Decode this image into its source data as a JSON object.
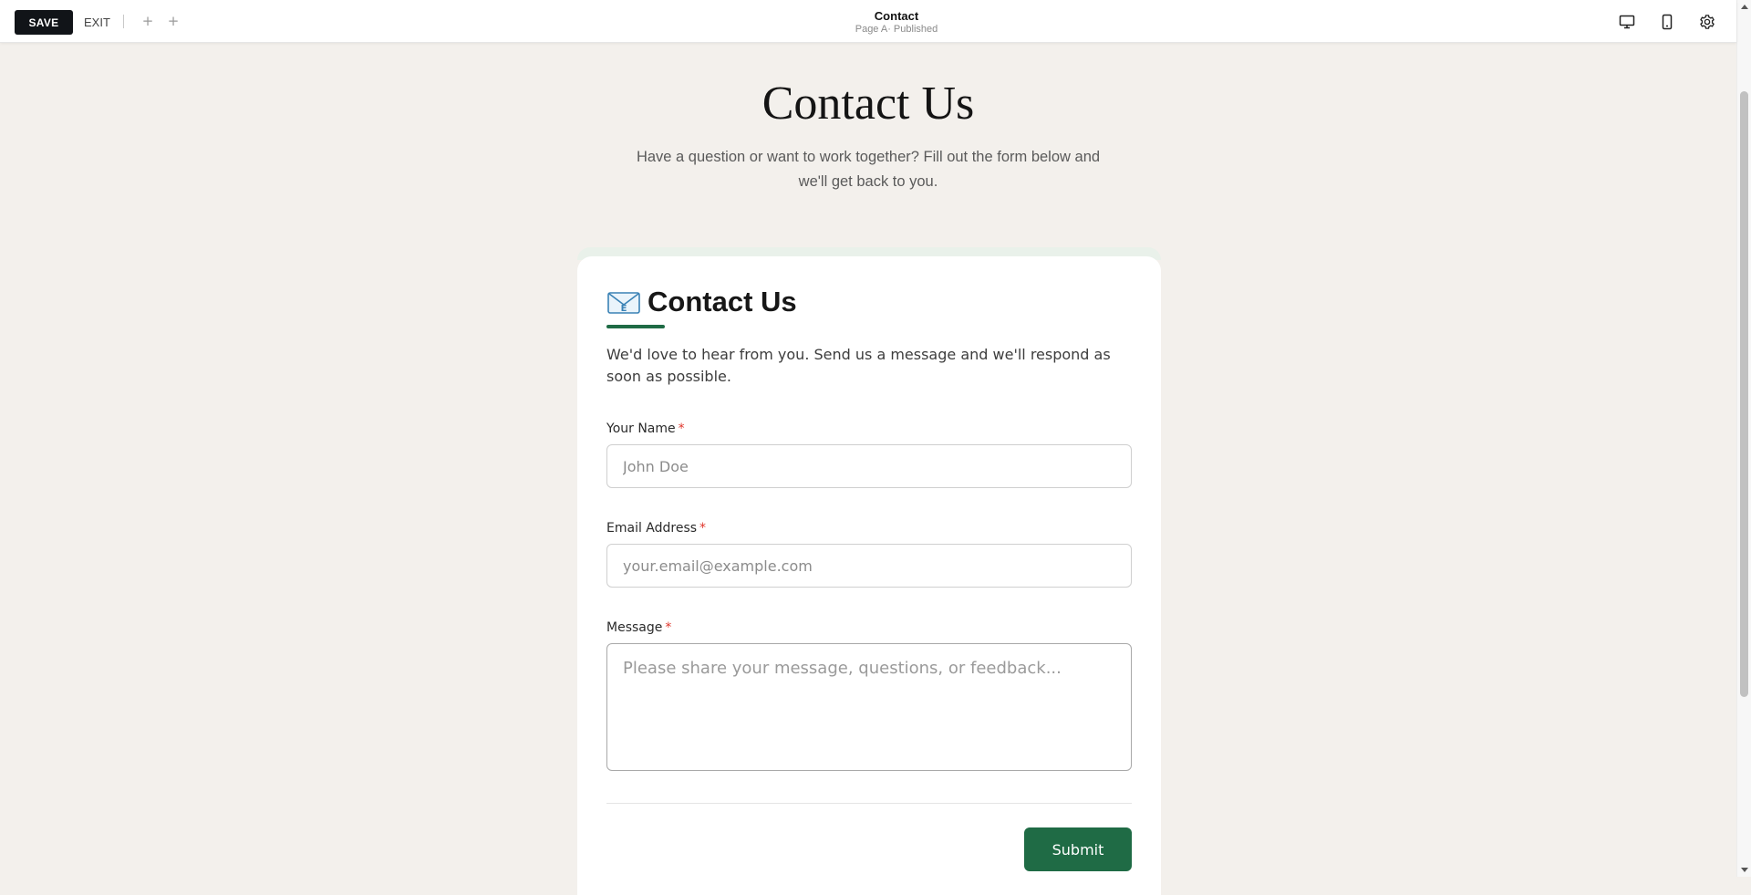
{
  "toolbar": {
    "save_label": "SAVE",
    "exit_label": "EXIT",
    "add_icon_1": "plus-icon",
    "add_icon_2": "plus-icon",
    "page_title": "Contact",
    "page_status": "Page A· Published",
    "icons": [
      "desktop-view-icon",
      "mobile-view-icon",
      "settings-icon"
    ]
  },
  "hero": {
    "title": "Contact Us",
    "subtitle": "Have a question or want to work together? Fill out the form below and we'll get back to you."
  },
  "form": {
    "icon": "envelope-icon",
    "title": "Contact Us",
    "description": "We'd love to hear from you. Send us a message and we'll respond as soon as possible.",
    "required_marker": "*",
    "fields": {
      "name": {
        "label": "Your Name",
        "placeholder": "John Doe"
      },
      "email": {
        "label": "Email Address",
        "placeholder": "your.email@example.com"
      },
      "message": {
        "label": "Message",
        "placeholder": "Please share your message, questions, or feedback..."
      }
    },
    "submit_label": "Submit"
  },
  "colors": {
    "accent": "#1f6b45",
    "page_background": "#f3f0ec",
    "required": "#e0362c",
    "save_button": "#111418"
  }
}
